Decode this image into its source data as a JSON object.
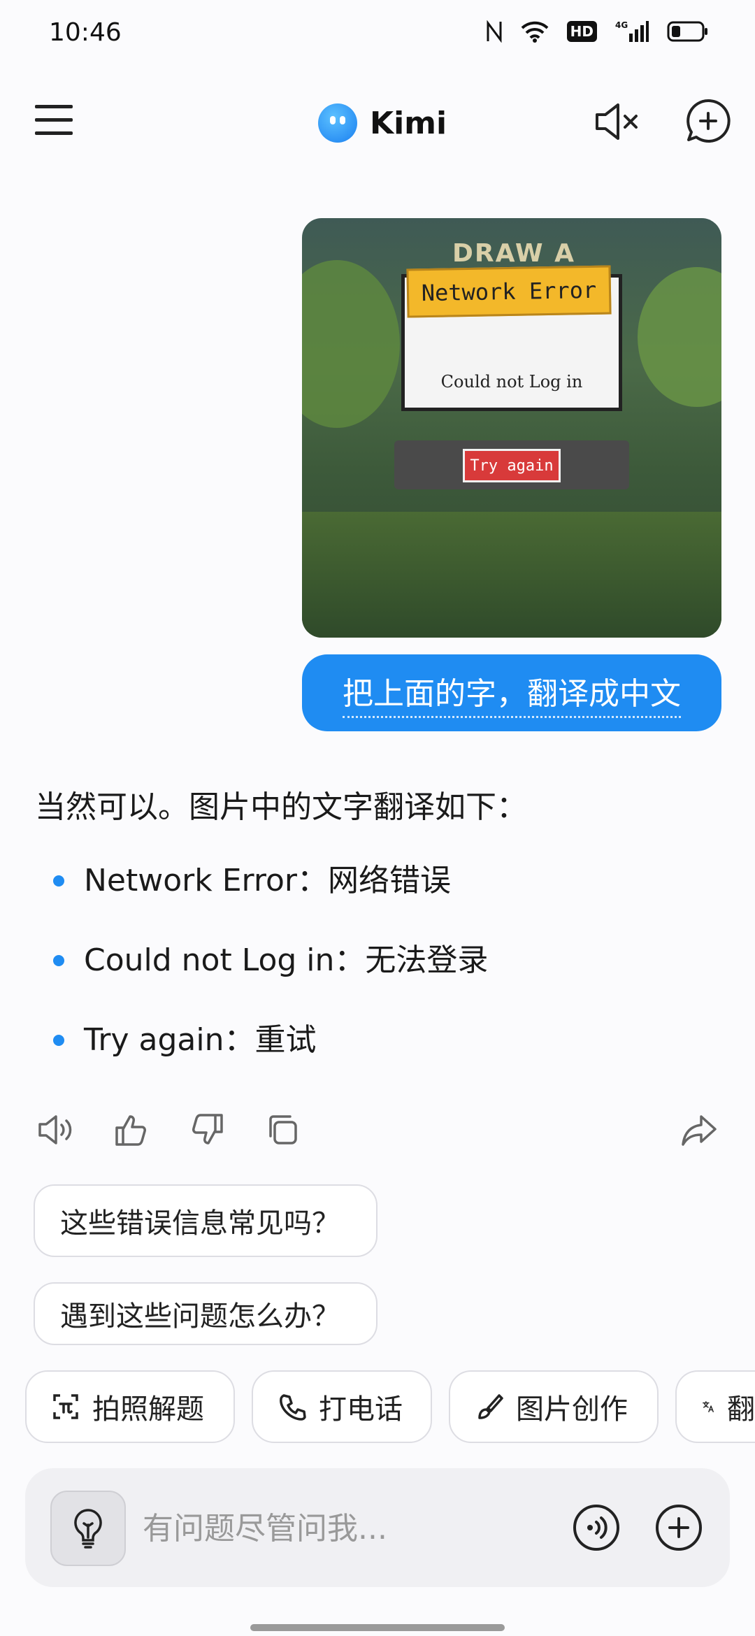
{
  "status_bar": {
    "time": "10:46",
    "hd": "HD",
    "network": "4G"
  },
  "header": {
    "app_name": "Kimi"
  },
  "screenshot_dialog": {
    "game_logo": "DRAW A",
    "title": "Network Error",
    "message": "Could not Log in",
    "button": "Try again"
  },
  "user_message": "把上面的字，翻译成中文",
  "assistant_reply": {
    "intro": "当然可以。图片中的文字翻译如下：",
    "items": [
      "Network Error：网络错误",
      "Could not Log in：无法登录",
      "Try again：重试"
    ]
  },
  "suggestions": [
    "这些错误信息常见吗？",
    "遇到这些问题怎么办？"
  ],
  "tools": [
    "拍照解题",
    "打电话",
    "图片创作",
    "翻"
  ],
  "composer": {
    "placeholder": "有问题尽管问我..."
  },
  "colors": {
    "accent": "#1f8cf2",
    "background": "#fbfbfd"
  },
  "icons": [
    "nfc-icon",
    "wifi-icon",
    "signal-icon",
    "battery-icon",
    "menu-icon",
    "mute-icon",
    "new-chat-icon",
    "speaker-icon",
    "thumbs-up-icon",
    "thumbs-down-icon",
    "copy-icon",
    "share-icon",
    "formula-icon",
    "phone-icon",
    "brush-icon",
    "translate-icon",
    "lightbulb-icon",
    "voice-icon",
    "plus-icon"
  ]
}
